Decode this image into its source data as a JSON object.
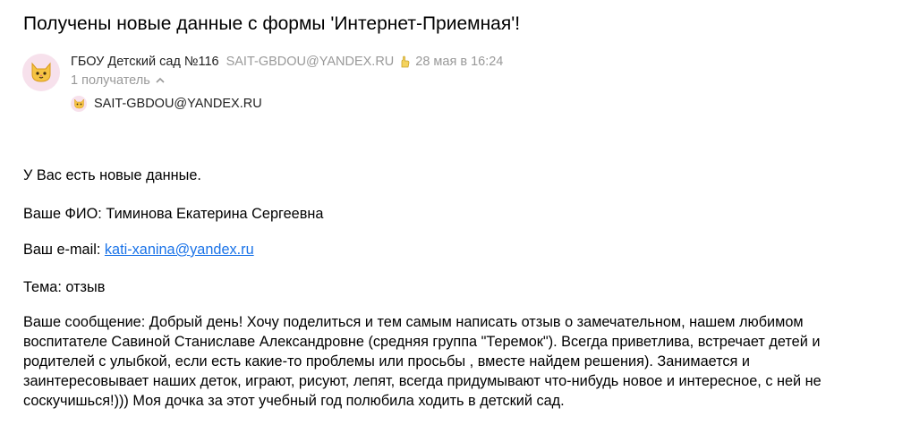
{
  "subject": "Получены новые данные с формы 'Интернет-Приемная'!",
  "sender": {
    "name": "ГБОУ Детский сад №116",
    "email": "SAIT-GBDOU@YANDEX.RU",
    "date": "28 мая в 16:24",
    "avatar_icon": "cat-face-icon",
    "date_icon": "hand-icon"
  },
  "recipients": {
    "toggle_label": "1 получатель",
    "toggle_icon": "chevron-up-icon",
    "items": [
      {
        "email": "SAIT-GBDOU@YANDEX.RU"
      }
    ]
  },
  "body": {
    "intro": "У Вас есть новые данные.",
    "fio": "Ваше ФИО: Тиминова Екатерина Сергеевна",
    "email_label": "Ваш e-mail: ",
    "email_value": "kati-xanina@yandex.ru",
    "topic": "Тема: отзыв",
    "message_lines": [
      "Ваше сообщение: Добрый день! Хочу поделиться и тем самым написать отзыв о замечательном, нашем любимом",
      "воспитателе Савиной Станиславе Александровне (средняя группа \"Теремок\"). Всегда приветлива, встречает детей и",
      "родителей с улыбкой, если есть какие-то проблемы или просьбы , вместе найдем решения). Занимается и",
      "заинтересовывает наших деток, играют, рисуют, лепят, всегда придумывают что-нибудь новое и интересное, с ней не",
      "соскучишься!))) Моя дочка за этот учебный год полюбила ходить в детский сад."
    ]
  },
  "colors": {
    "avatar_bg": "#f7e1ec",
    "muted": "#999999",
    "link": "#1a73e8"
  }
}
